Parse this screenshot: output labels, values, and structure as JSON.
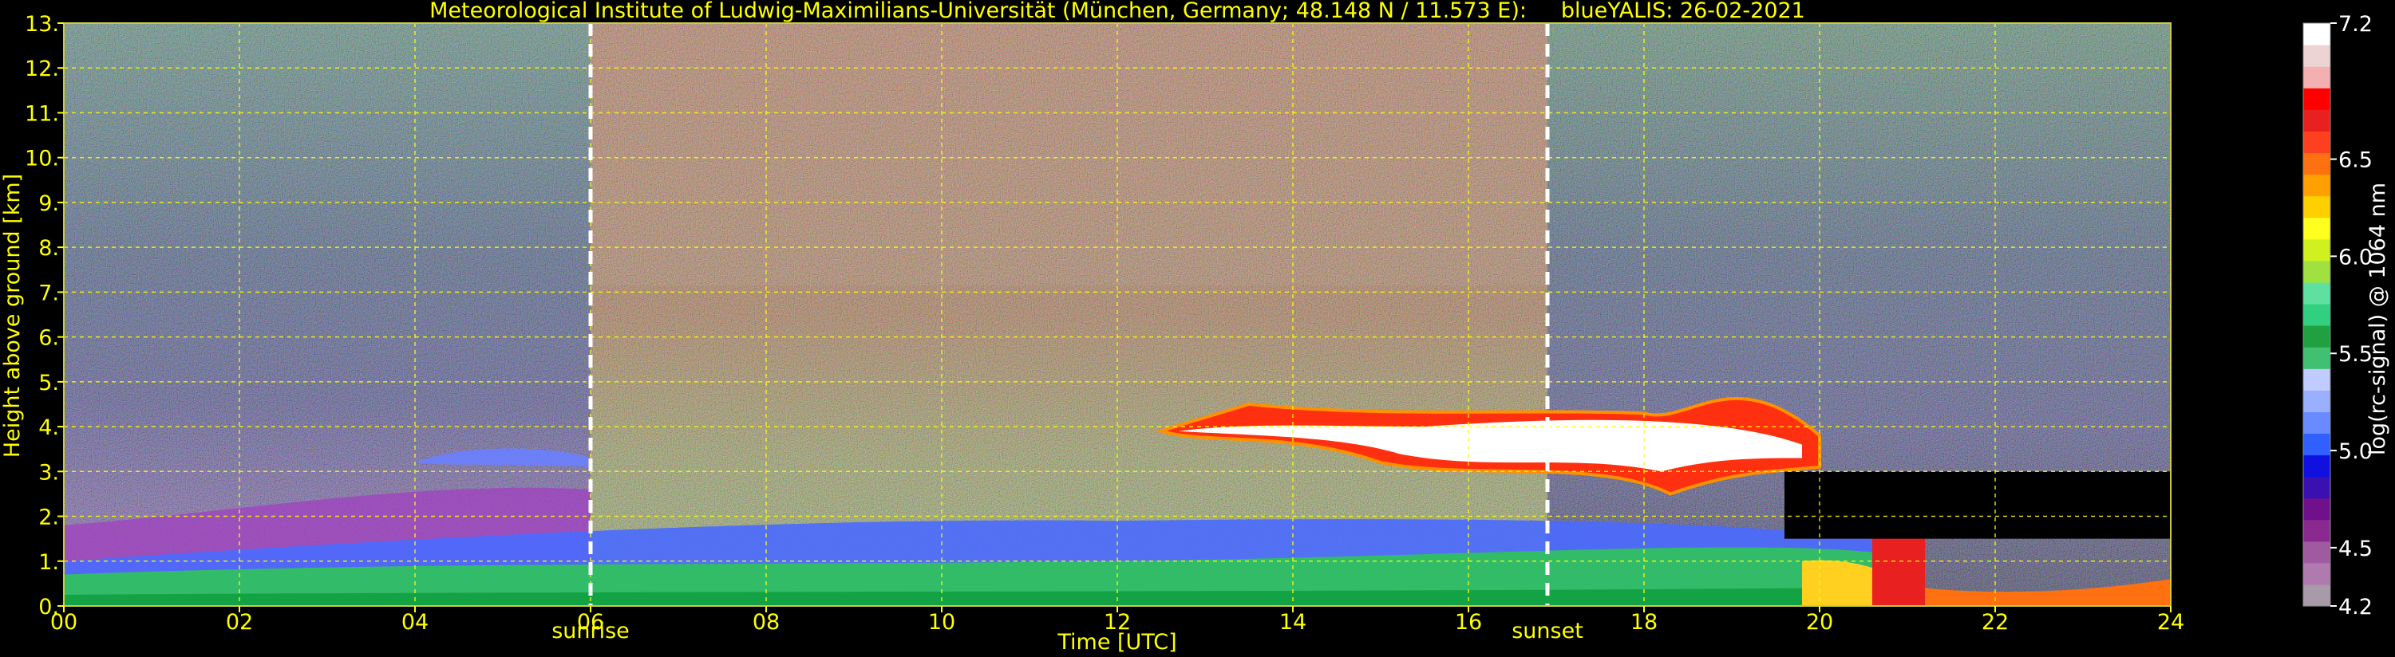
{
  "chart_data": {
    "type": "heatmap",
    "title": "Meteorological Institute of Ludwig-Maximilians-Universität (München, Germany; 48.148 N / 11.573 E):     blueYALIS: 26-02-2021",
    "xlabel": "Time [UTC]",
    "ylabel": "Height above ground [km]",
    "xlim": [
      0,
      24
    ],
    "ylim": [
      0,
      13
    ],
    "x_ticks": [
      "00",
      "02",
      "04",
      "06",
      "08",
      "10",
      "12",
      "14",
      "16",
      "18",
      "20",
      "22",
      "24"
    ],
    "x_tick_values": [
      0,
      2,
      4,
      6,
      8,
      10,
      12,
      14,
      16,
      18,
      20,
      22,
      24
    ],
    "y_ticks": [
      "0.",
      "1.",
      "2.",
      "3.",
      "4.",
      "5.",
      "6.",
      "7.",
      "8.",
      "9.",
      "10.",
      "11.",
      "12.",
      "13."
    ],
    "y_tick_values": [
      0,
      1,
      2,
      3,
      4,
      5,
      6,
      7,
      8,
      9,
      10,
      11,
      12,
      13
    ],
    "grid": true,
    "grid_color": "#ffff00",
    "markers": [
      {
        "label": "sunrise",
        "time": 6.0
      },
      {
        "label": "sunset",
        "time": 16.9
      }
    ],
    "colorbar": {
      "label": "log(rc-signal) @ 1064 nm",
      "range": [
        4.2,
        7.2
      ],
      "tick_labels": [
        "7.2",
        "6.5",
        "6.0",
        "5.5",
        "5.0",
        "4.5",
        "4.2"
      ],
      "tick_values": [
        7.2,
        6.5,
        6.0,
        5.5,
        5.0,
        4.5,
        4.2
      ],
      "colors": [
        "#a89aa8",
        "#b07ab0",
        "#a05aa0",
        "#8a2a90",
        "#70108a",
        "#3a10b0",
        "#1010e0",
        "#3060ff",
        "#6a8aff",
        "#9ab0ff",
        "#c0ccff",
        "#40c070",
        "#20a040",
        "#30d080",
        "#60e0a0",
        "#a0e040",
        "#d0f020",
        "#ffff20",
        "#ffd000",
        "#ffa000",
        "#ff7010",
        "#ff4020",
        "#e82020",
        "#ff0000",
        "#f4b0b0",
        "#ecd4d4",
        "#ffffff"
      ]
    },
    "features": [
      {
        "label": "cloud layer",
        "t_start": 12.5,
        "t_end": 20.0,
        "h_bottom": 3.0,
        "h_top": 4.5
      },
      {
        "label": "boundary layer",
        "t_start": 0,
        "t_end": 24,
        "h_bottom": 0,
        "h_top": 1.5
      }
    ]
  }
}
